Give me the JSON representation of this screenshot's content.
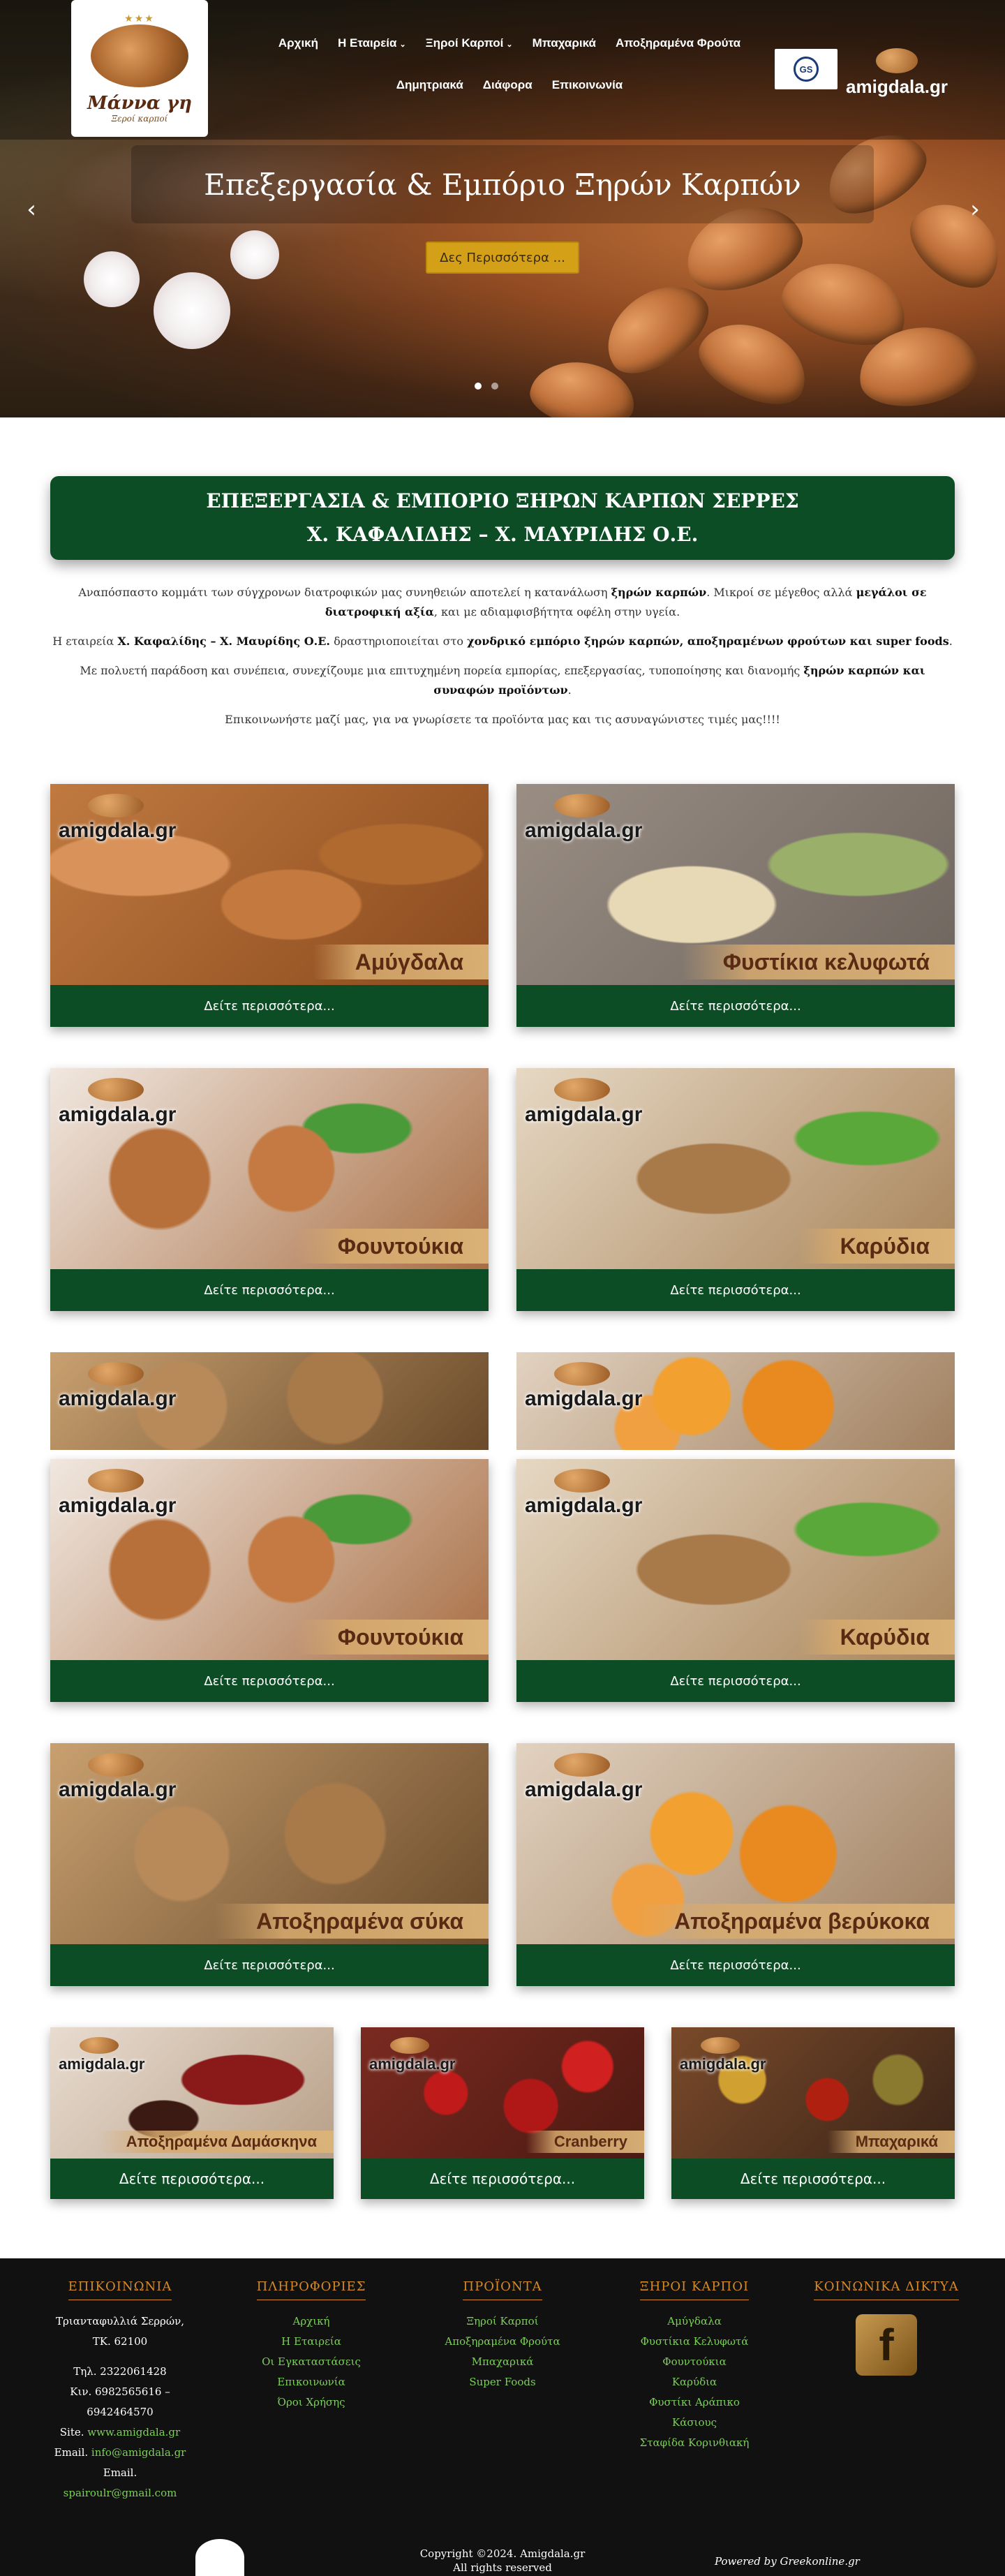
{
  "logo": {
    "brand": "Μάννα γη",
    "subtitle": "Ξεροί καρποί",
    "stars": "★★★"
  },
  "nav": {
    "items": [
      {
        "label": "Αρχική",
        "caret": ""
      },
      {
        "label": "Η Εταιρεία",
        "caret": "⌄"
      },
      {
        "label": "Ξηροί Καρποί",
        "caret": "⌄"
      },
      {
        "label": "Μπαχαρικά",
        "caret": ""
      },
      {
        "label": "Αποξηραμένα Φρούτα",
        "caret": ""
      },
      {
        "label": "Δημητριακά",
        "caret": ""
      },
      {
        "label": "Διάφορα",
        "caret": ""
      },
      {
        "label": "Επικοινωνία",
        "caret": ""
      }
    ]
  },
  "header": {
    "badge_text": "GS",
    "brand_text": "amigdala.gr"
  },
  "hero": {
    "title": "Επεξεργασία & Εμπόριο Ξηρών Καρπών",
    "button": "Δες Περισσότερα ...",
    "arrow_left": "‹",
    "arrow_right": "›"
  },
  "company": {
    "line1": "ΕΠΕΞΕΡΓΑΣΙΑ & ΕΜΠΟΡΙΟ ΞΗΡΩΝ ΚΑΡΠΩΝ ΣΕΡΡΕΣ",
    "line2": "Χ. ΚΑΦΑΛΙΔΗΣ – Χ. ΜΑΥΡΙΔΗΣ Ο.Ε."
  },
  "intro": {
    "p1_a": "Αναπόσπαστο κομμάτι των σύγχρονων διατροφικών μας συνηθειών αποτελεί η κατανάλωση ",
    "p1_b": "ξηρών καρπών",
    "p1_c": ". Μικροί σε μέγεθος αλλά ",
    "p1_d": "μεγάλοι σε διατροφική αξία",
    "p1_e": ", και με αδιαμφισβήτητα οφέλη στην υγεία.",
    "p2_a": "Η εταιρεία ",
    "p2_b": "Χ. Καφαλίδης – Χ. Μαυρίδης Ο.Ε.",
    "p2_c": " δραστηριοποιείται στο ",
    "p2_d": "χονδρικό εμπόριο ξηρών καρπών, αποξηραμένων φρούτων και super foods",
    "p2_e": ".",
    "p3_a": "Με πολυετή παράδοση και συνέπεια, συνεχίζουμε μια επιτυχημένη πορεία εμπορίας, επεξεργασίας, τυποποίησης και διανομής ",
    "p3_b": "ξηρών καρπών και συναφών προϊόντων",
    "p3_c": ".",
    "p4": "Επικοινωνήστε μαζί μας, για να γνωρίσετε τα προϊόντα μας και τις ασυναγώνιστες τιμές μας!!!!"
  },
  "watermark": "amigdala.gr",
  "more_label": "Δείτε περισσότερα...",
  "products": {
    "almonds": "Αμύγδαλα",
    "pistachios": "Φυστίκια κελυφωτά",
    "hazelnuts": "Φουντούκια",
    "walnuts": "Καρύδια",
    "hazelnuts2": "Φουντούκια",
    "walnuts2": "Καρύδια",
    "figs": "Αποξηραμένα σύκα",
    "apricots": "Αποξηραμένα βερύκοκα",
    "plums": "Αποξηραμένα Δαμάσκηνα",
    "cranberry": "Cranberry",
    "spices": "Μπαχαρικά"
  },
  "footer": {
    "contact": {
      "title": "ΕΠΙΚΟΙΝΩΝΙΑ",
      "address1": "Τριανταφυλλιά Σερρών,",
      "address2": "ΤΚ. 62100",
      "phone": "Τηλ. 2322061428",
      "mobile1": "Κιν. 6982565616 –",
      "mobile2": "6942464570",
      "site_label": "Site. ",
      "site": "www.amigdala.gr",
      "email_label": "Email. ",
      "email": "info@amigdala.gr",
      "email2_label": "Email.",
      "email2": "spairoulr@gmail.com"
    },
    "info": {
      "title": "ΠΛΗΡΟΦΟΡΙΕΣ",
      "links": [
        "Αρχική",
        "Η Εταιρεία",
        "Οι Εγκαταστάσεις",
        "Επικοινωνία",
        "Όροι Χρήσης"
      ]
    },
    "products": {
      "title": "ΠΡΟΪΟΝΤΑ",
      "links": [
        "Ξηροί Καρποί",
        "Αποξηραμένα Φρούτα",
        "Μπαχαρικά",
        "Super Foods"
      ]
    },
    "nuts": {
      "title": "ΞΗΡΟΙ ΚΑΡΠΟΙ",
      "links": [
        "Αμύγδαλα",
        "Φυστίκια Κελυφωτά",
        "Φουντούκια",
        "Καρύδια",
        "Φυστίκι Αράπικο",
        "Κάσιους",
        "Σταφίδα Κορινθιακή"
      ]
    },
    "social": {
      "title": "ΚΟΙΝΩΝΙΚΑ ΔΙΚΤΥΑ",
      "fb_glyph": "f"
    },
    "copyright1": "Copyright ©2024. Amigdala.gr",
    "copyright2": "All rights reserved",
    "powered": "Powered by Greekonline.gr"
  }
}
